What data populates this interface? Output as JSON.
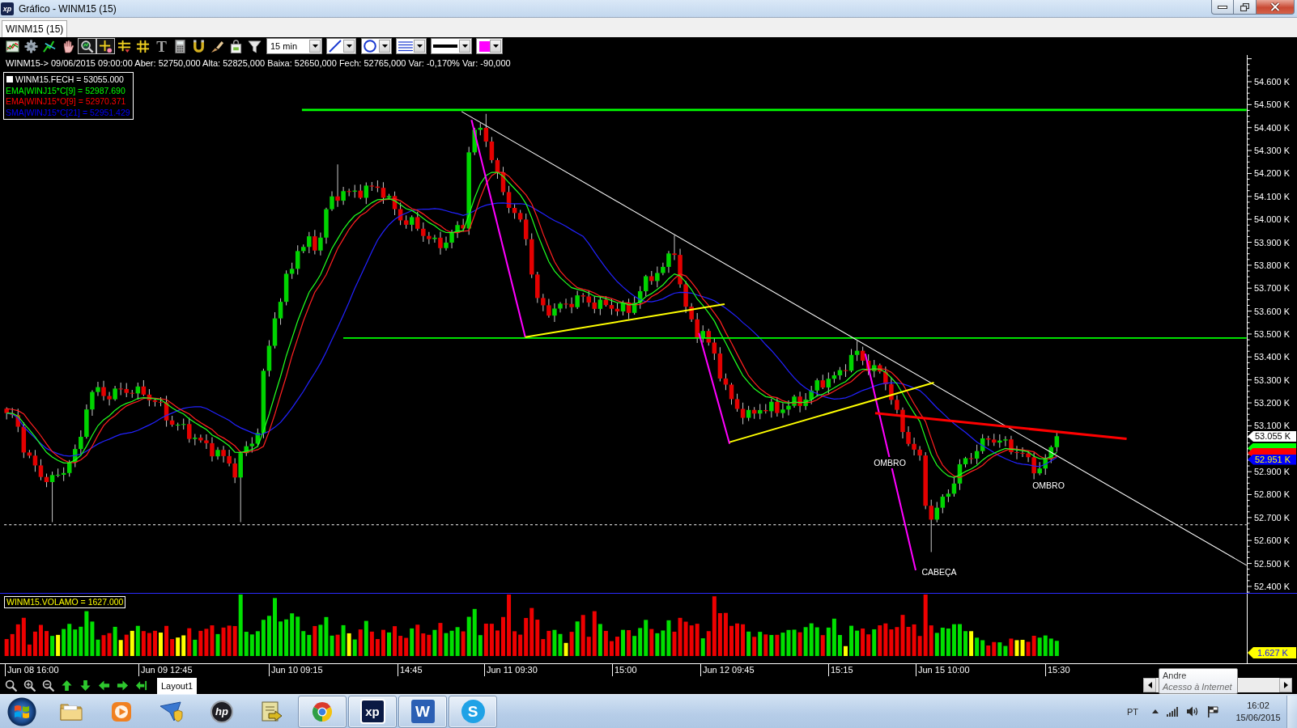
{
  "window": {
    "icon_label": "xp",
    "title": "Gráfico - WINM15 (15)"
  },
  "tabs": [
    {
      "label": "WINM15 (15)",
      "selected": true
    }
  ],
  "toolbar": {
    "tools": [
      {
        "selected": false
      },
      {
        "selected": false
      },
      {
        "selected": false
      },
      {
        "selected": false
      },
      {
        "selected": true
      },
      {
        "selected": true
      },
      {
        "selected": false
      },
      {
        "selected": false
      },
      {
        "selected": false,
        "glyph": "T"
      },
      {
        "selected": false
      },
      {
        "selected": false
      },
      {
        "selected": false
      },
      {
        "selected": false
      },
      {
        "selected": false
      }
    ],
    "interval": "15 min",
    "color": "#ff00ff"
  },
  "quote_line": "WINM15-> 09/06/2015 09:00:00 Aber: 52750,000 Alta: 52825,000 Baixa: 52650,000 Fech: 52765,000 Var: -0,170% Var: -90,000",
  "legend": [
    {
      "label": "WINM15.FECH = 53055.000",
      "color": "#ffffff",
      "swatch": true
    },
    {
      "label": "EMA|WINJ15*C[9] = 52987.690",
      "color": "#00ff00",
      "swatch": false
    },
    {
      "label": "EMA|WINJ15*O[9] = 52970.371",
      "color": "#ff0000",
      "swatch": false
    },
    {
      "label": "SMA|WINJ15*C[21] = 52951.429",
      "color": "#0000ff",
      "swatch": false
    }
  ],
  "chart_labels": [
    "OMBRO",
    "OMBRO",
    "CABEÇA"
  ],
  "price_axis": [
    "54.600 K",
    "54.500 K",
    "54.400 K",
    "54.300 K",
    "54.200 K",
    "54.100 K",
    "54.000 K",
    "53.900 K",
    "53.800 K",
    "53.700 K",
    "53.600 K",
    "53.500 K",
    "53.400 K",
    "53.300 K",
    "53.200 K",
    "53.100 K",
    "52.900 K",
    "52.800 K",
    "52.700 K",
    "52.600 K",
    "52.500 K",
    "52.400 K"
  ],
  "price_tags": [
    {
      "text": "53.055 K",
      "color": "#ffffff"
    },
    {
      "color": "#00ff00"
    },
    {
      "color": "#ff0000"
    },
    {
      "text": "52.951 K",
      "color": "#0000ff"
    }
  ],
  "volume": {
    "legend": "WINM15.VOLAMO = 1627.000",
    "tag": "1.627 K"
  },
  "time_axis": [
    "Jun 08 16:00",
    "Jun 09 12:45",
    "Jun 10 09:15",
    "14:45",
    "Jun 11 09:30",
    "15:00",
    "Jun 12 09:45",
    "15:15",
    "Jun 15 10:00",
    "15:30"
  ],
  "layouts": [
    {
      "label": "Layout1",
      "selected": true
    }
  ],
  "network_tooltip": {
    "title": "Andre",
    "status": "Acesso à Internet"
  },
  "taskbar": {
    "apps": [
      {
        "open": false
      },
      {
        "open": false
      },
      {
        "open": false
      },
      {
        "open": false,
        "label": "hp"
      },
      {
        "open": false
      },
      {
        "open": true
      },
      {
        "open": true,
        "label": "xp"
      },
      {
        "open": true,
        "label": "W"
      },
      {
        "open": true,
        "label": "S"
      }
    ],
    "language": "PT",
    "time": "16:02",
    "date": "15/06/2015"
  }
}
